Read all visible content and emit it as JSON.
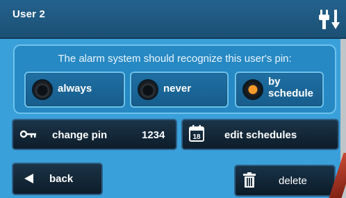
{
  "header": {
    "title": "User 2",
    "status_icon": "plug-icon"
  },
  "pin_panel": {
    "prompt": "The alarm system should recognize this user's pin:",
    "options": [
      {
        "label": "always",
        "selected": false
      },
      {
        "label": "never",
        "selected": false
      },
      {
        "label_line1": "by",
        "label_line2": "schedule",
        "selected": true
      }
    ]
  },
  "actions": {
    "change_pin_label": "change pin",
    "pin_value": "1234",
    "calendar_day": "18",
    "edit_schedules_label": "edit schedules",
    "back_label": "back",
    "delete_label": "delete"
  },
  "colors": {
    "background": "#3aa0da",
    "titlebar": "#1c4f74",
    "selected_radio": "#f59a2a"
  }
}
